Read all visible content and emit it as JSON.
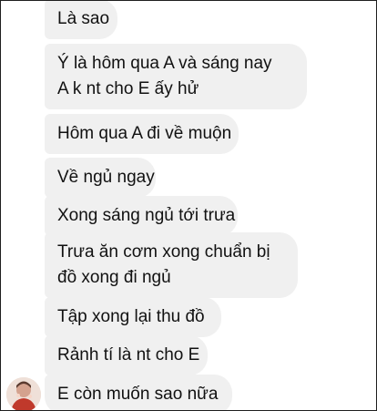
{
  "messages": [
    {
      "lines": [
        "Là sao"
      ]
    },
    {
      "lines": [
        "Ý là hôm qua A và sáng nay",
        "A k nt cho E ấy hử"
      ]
    },
    {
      "lines": [
        "Hôm qua A đi về muộn"
      ]
    },
    {
      "lines": [
        "Về ngủ ngay"
      ]
    },
    {
      "lines": [
        "Xong sáng ngủ tới trưa"
      ]
    },
    {
      "lines": [
        "Trưa ăn cơm xong chuẩn bị",
        "đồ xong đi ngủ"
      ]
    },
    {
      "lines": [
        "Tập xong lại thu đồ"
      ]
    },
    {
      "lines": [
        "Rảnh tí là nt cho E"
      ]
    },
    {
      "lines": [
        "E còn muốn sao nữa"
      ]
    }
  ],
  "colors": {
    "bubble_bg": "#f0f0f0",
    "text": "#111111",
    "frame_border": "#1e1e1e"
  },
  "avatar_icon": "user-avatar-icon"
}
